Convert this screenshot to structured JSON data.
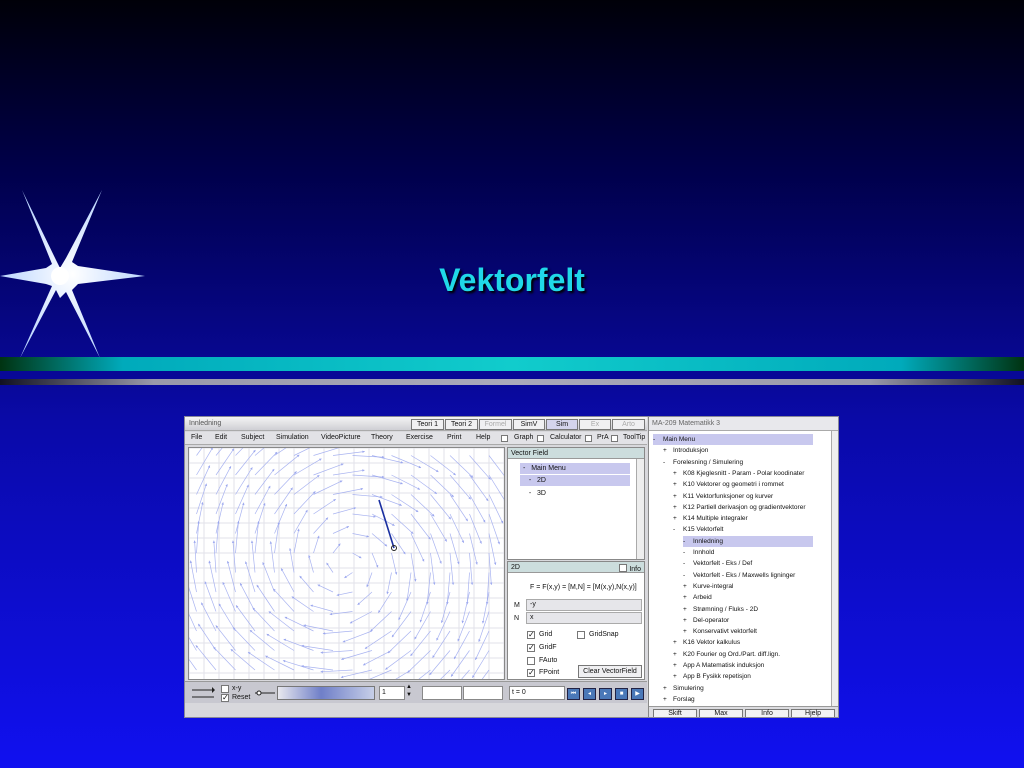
{
  "slide": {
    "title": "Vektorfelt"
  },
  "app": {
    "window_title": "Innledning",
    "tabs": [
      "Teori 1",
      "Teori 2",
      "Formel",
      "SimV",
      "Sim",
      "Ex",
      "Arto"
    ],
    "menu": [
      "File",
      "Edit",
      "Subject",
      "Simulation",
      "VideoPicture",
      "Theory",
      "Exercise",
      "Print",
      "Help"
    ],
    "menu_toggles": [
      "Graph",
      "Calculator",
      "PrA",
      "ToolTip"
    ],
    "vector_field_panel": {
      "title": "Vector Field",
      "items": [
        {
          "bullet": "-",
          "label": "Main Menu"
        },
        {
          "bullet": "-",
          "label": "2D"
        },
        {
          "bullet": "-",
          "label": "3D"
        }
      ]
    },
    "settings_panel": {
      "mode": "2D",
      "info_label": "Info",
      "formula": "F = F(x,y) = [M,N] = [M(x,y),N(x,y)]",
      "m_label": "M",
      "m_value": "-y",
      "n_label": "N",
      "n_value": "x",
      "checks": [
        {
          "label": "Grid",
          "checked": true
        },
        {
          "label": "GridSnap",
          "checked": false
        },
        {
          "label": "GridF",
          "checked": true
        },
        {
          "label": "FAuto",
          "checked": false
        },
        {
          "label": "FPoint",
          "checked": true
        }
      ],
      "clear_button": "Clear VectorField"
    },
    "bottom_bar": {
      "mode_top": "x-y",
      "reset": "Reset",
      "stepper_value": "1",
      "time": "t = 0"
    }
  },
  "menu_panel": {
    "title": "MA-209 Matematikk 3",
    "tree": [
      {
        "b": "-",
        "t": "Main Menu",
        "l": 0,
        "sel": true
      },
      {
        "b": "+",
        "t": "Introduksjon",
        "l": 1
      },
      {
        "b": "-",
        "t": "Forelesning / Simulering",
        "l": 1
      },
      {
        "b": "+",
        "t": "K08 Kjeglesnitt - Param - Polar koodinater",
        "l": 2
      },
      {
        "b": "+",
        "t": "K10 Vektorer og geometri i rommet",
        "l": 2
      },
      {
        "b": "+",
        "t": "K11 Vektorfunksjoner og kurver",
        "l": 2
      },
      {
        "b": "+",
        "t": "K12 Partiell derivasjon og gradientvektorer",
        "l": 2
      },
      {
        "b": "+",
        "t": "K14 Multiple integraler",
        "l": 2
      },
      {
        "b": "-",
        "t": "K15 Vektorfelt",
        "l": 2
      },
      {
        "b": "-",
        "t": "Innledning",
        "l": 3,
        "sel": true
      },
      {
        "b": "-",
        "t": "Innhold",
        "l": 3
      },
      {
        "b": "-",
        "t": "Vektorfelt - Eks / Def",
        "l": 3
      },
      {
        "b": "-",
        "t": "Vektorfelt - Eks / Maxwells ligninger",
        "l": 3
      },
      {
        "b": "+",
        "t": "Kurve-integral",
        "l": 3
      },
      {
        "b": "+",
        "t": "Arbeid",
        "l": 3
      },
      {
        "b": "+",
        "t": "Strømning / Fluks - 2D",
        "l": 3
      },
      {
        "b": "+",
        "t": "Del-operator",
        "l": 3
      },
      {
        "b": "+",
        "t": "Konservativt vektorfelt",
        "l": 3
      },
      {
        "b": "+",
        "t": "K16 Vektor kalkulus",
        "l": 2
      },
      {
        "b": "+",
        "t": "K20 Fourier og Ord./Part. diff.lign.",
        "l": 2
      },
      {
        "b": "+",
        "t": "App A Matematisk induksjon",
        "l": 2
      },
      {
        "b": "+",
        "t": "App B Fysikk repetisjon",
        "l": 2
      },
      {
        "b": "+",
        "t": "Simulering",
        "l": 1
      },
      {
        "b": "+",
        "t": "Forslag",
        "l": 1
      }
    ],
    "footer": [
      "Skift",
      "Max",
      "Info",
      "Hjelp"
    ]
  },
  "colors": {
    "title": "#20d8e8",
    "field_arrows": "#9aa6ee",
    "accent_vector": "#1a2fa0"
  }
}
